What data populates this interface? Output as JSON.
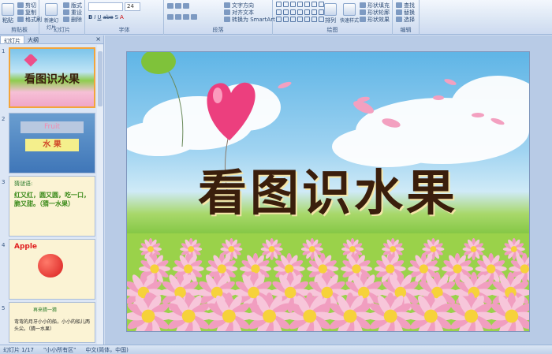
{
  "ribbon": {
    "clipboard": {
      "label": "剪贴板",
      "paste": "粘贴",
      "cut": "剪切",
      "copy": "复制",
      "format_painter": "格式刷"
    },
    "slides": {
      "label": "幻灯片",
      "new_slide": "新建幻灯片",
      "layout": "版式",
      "reset": "重设",
      "delete": "删除"
    },
    "font": {
      "label": "字体",
      "size": "24"
    },
    "paragraph": {
      "label": "段落",
      "text_direction": "文字方向",
      "align_text": "对齐文本",
      "smartart": "转换为 SmartArt"
    },
    "drawing": {
      "label": "绘图",
      "arrange": "排列",
      "quick_styles": "快速样式",
      "fill": "形状填充",
      "outline": "形状轮廓",
      "effects": "形状效果"
    },
    "editing": {
      "label": "编辑",
      "find": "查找",
      "replace": "替换",
      "select": "选择"
    }
  },
  "sidebar": {
    "tabs": [
      "幻灯片",
      "大纲"
    ],
    "close": "×",
    "slides": [
      {
        "num": "1",
        "title": "看图识水果"
      },
      {
        "num": "2",
        "line1": "Fruit",
        "line2": "水 果"
      },
      {
        "num": "3",
        "header": "猜谜语:",
        "body": "红又红，圆又圆，吃一口，脆又甜。（猜一水果）"
      },
      {
        "num": "4",
        "header": "Apple"
      },
      {
        "num": "5",
        "header": "再来猜一猜",
        "body": "弯弯的月牙小小的船，小小的船儿两头尖。（猜一水果）"
      }
    ]
  },
  "slide": {
    "title": "看图识水果"
  },
  "status": {
    "slide_count": "幻灯片 1/17",
    "theme": "\"小小所有区\"",
    "language": "中文(简体，中国)"
  }
}
